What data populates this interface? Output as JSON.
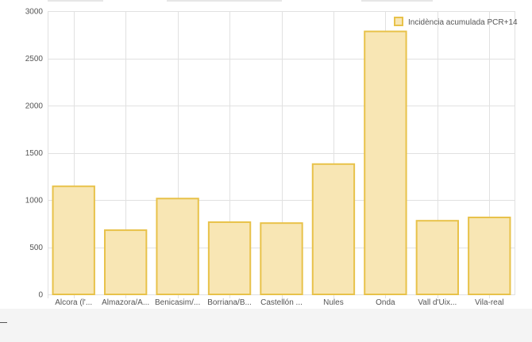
{
  "colors": {
    "bar_fill": "#f8e6b4",
    "bar_stroke": "#e8c24a",
    "grid": "#e1e1e1",
    "axis_text": "#555555"
  },
  "chart_data": {
    "type": "bar",
    "categories": [
      "Alcora (l'...",
      "Almazora/A...",
      "Benicasim/...",
      "Borriana/B...",
      "Castellón ...",
      "Nules",
      "Onda",
      "Vall d'Uix...",
      "Vila-real"
    ],
    "series": [
      {
        "name": "Incidència acumulada PCR+14",
        "values": [
          1145,
          680,
          1015,
          765,
          755,
          1380,
          2785,
          780,
          815
        ]
      }
    ],
    "title": "",
    "xlabel": "",
    "ylabel": "",
    "ylim": [
      0,
      3000
    ],
    "yticks": [
      0,
      500,
      1000,
      1500,
      2000,
      2500,
      3000
    ],
    "grid": true,
    "legend_position": "top-right"
  }
}
